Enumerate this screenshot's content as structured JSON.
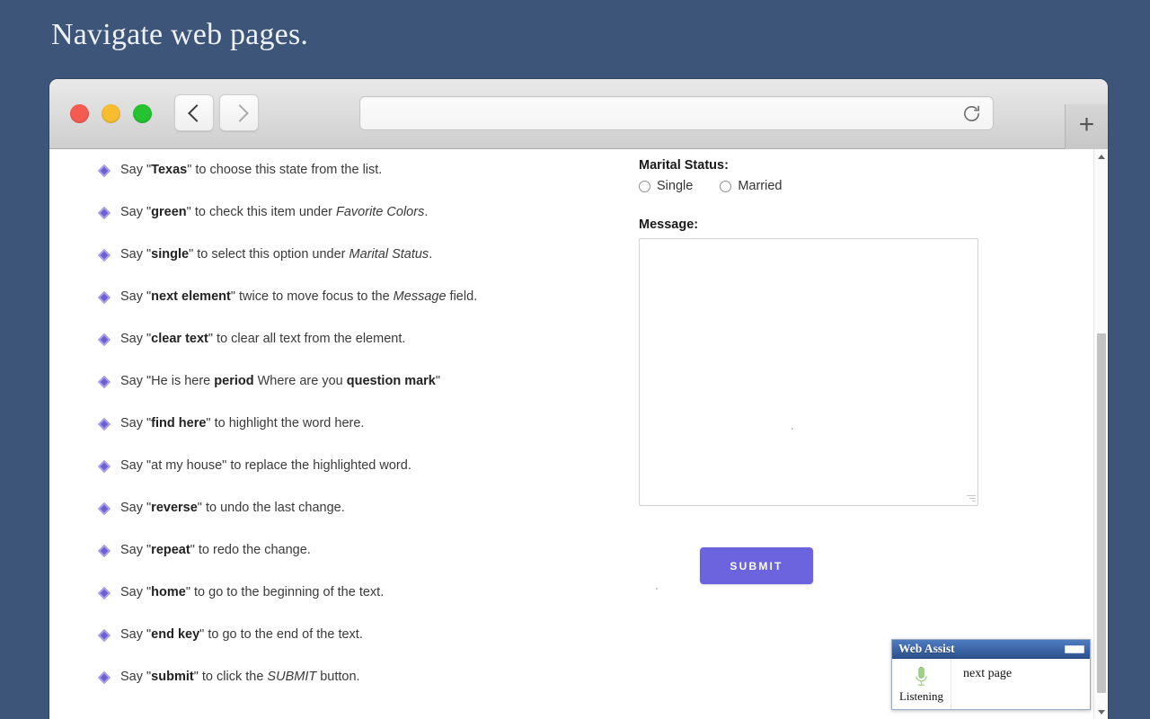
{
  "slide": {
    "title": "Navigate web pages."
  },
  "browser": {
    "traffic_lights": [
      "close-red",
      "minimize-yellow",
      "maximize-green"
    ],
    "back_label": "Back",
    "forward_label": "Forward",
    "address_value": "",
    "address_placeholder": "",
    "reload_label": "Reload",
    "new_tab_label": "+"
  },
  "instructions": [
    {
      "prefix": "Say \"",
      "cmd": "Texas",
      "suffix": "\" to choose this state from the list.",
      "em": ""
    },
    {
      "prefix": "Say \"",
      "cmd": "green",
      "suffix": "\" to check this item under ",
      "em": "Favorite Colors",
      "tail": "."
    },
    {
      "prefix": "Say \"",
      "cmd": "single",
      "suffix": "\" to select this option under ",
      "em": "Marital Status",
      "tail": "."
    },
    {
      "prefix": "Say \"",
      "cmd": "next element",
      "suffix": "\" twice to move focus to the ",
      "em": "Message",
      "tail": " field."
    },
    {
      "prefix": "Say \"",
      "cmd": "clear text",
      "suffix": "\" to clear all text from the element.",
      "em": ""
    },
    {
      "prefix": "Say \"He is here ",
      "cmd": "period",
      "suffix": " Where are you ",
      "em": "",
      "cmd2": "question mark",
      "tail": "\""
    },
    {
      "prefix": "Say \"",
      "cmd": "find here",
      "suffix": "\" to highlight the word here.",
      "em": ""
    },
    {
      "prefix": "Say \"at my house\" to replace the highlighted word.",
      "cmd": "",
      "suffix": "",
      "em": ""
    },
    {
      "prefix": "Say \"",
      "cmd": "reverse",
      "suffix": "\" to undo the last change.",
      "em": ""
    },
    {
      "prefix": "Say \"",
      "cmd": "repeat",
      "suffix": "\" to redo the change.",
      "em": ""
    },
    {
      "prefix": "Say \"",
      "cmd": "home",
      "suffix": "\" to go to the beginning of the text.",
      "em": ""
    },
    {
      "prefix": "Say \"",
      "cmd": "end key",
      "suffix": "\" to go to the end of the text.",
      "em": ""
    },
    {
      "prefix": "Say \"",
      "cmd": "submit",
      "suffix": "\" to click the ",
      "em": "SUBMIT",
      "tail": " button."
    }
  ],
  "form": {
    "marital_status_label": "Marital Status:",
    "options": [
      {
        "label": "Single",
        "checked": false
      },
      {
        "label": "Married",
        "checked": false
      }
    ],
    "message_label": "Message:",
    "message_value": "",
    "submit_label": "SUBMIT"
  },
  "web_assist": {
    "title": "Web Assist",
    "minimize_label": "Minimize",
    "mic_status": "Listening",
    "recognized_text": "next page"
  },
  "colors": {
    "slide_background": "#3d5578",
    "accent_purple": "#6c63de",
    "bullet_purple": "#6b5fd4",
    "assist_blue": "#2d538f",
    "mic_green": "#8fce7a"
  }
}
